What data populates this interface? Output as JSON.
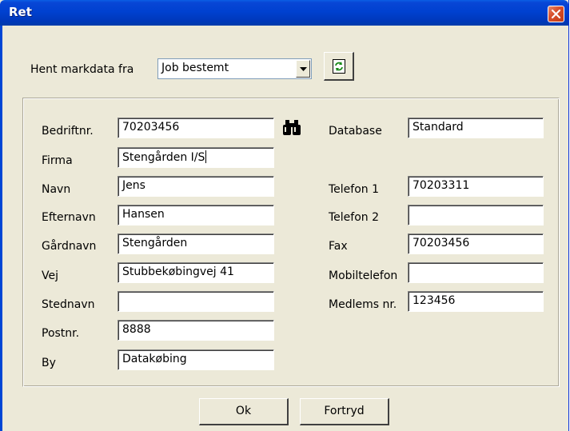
{
  "window": {
    "title": "Ret"
  },
  "source": {
    "label": "Hent markdata fra",
    "selected": "Job bestemt"
  },
  "fields_left": [
    {
      "label": "Bedriftnr.",
      "value": "70203456"
    },
    {
      "label": "Firma",
      "value": "Stengården I/S"
    },
    {
      "label": "Navn",
      "value": "Jens"
    },
    {
      "label": "Efternavn",
      "value": "Hansen"
    },
    {
      "label": "Gårdnavn",
      "value": "Stengården"
    },
    {
      "label": "Vej",
      "value": "Stubbekøbingvej 41"
    },
    {
      "label": "Stednavn",
      "value": ""
    },
    {
      "label": "Postnr.",
      "value": "8888"
    },
    {
      "label": "By",
      "value": "Datakøbing"
    }
  ],
  "fields_right": [
    {
      "label": "Database",
      "value": "Standard"
    },
    {
      "label": "Telefon 1",
      "value": "70203311"
    },
    {
      "label": "Telefon 2",
      "value": ""
    },
    {
      "label": "Fax",
      "value": "70203456"
    },
    {
      "label": "Mobiltelefon",
      "value": ""
    },
    {
      "label": "Medlems nr.",
      "value": "123456"
    }
  ],
  "buttons": {
    "ok": "Ok",
    "cancel": "Fortryd"
  },
  "icons": {
    "close": "close-icon",
    "dropdown": "chevron-down-icon",
    "refresh": "refresh-icon",
    "lookup": "binoculars-icon"
  },
  "colors": {
    "titlebar": "#0041d0",
    "dialog": "#ece9d8",
    "close": "#c33b15"
  }
}
